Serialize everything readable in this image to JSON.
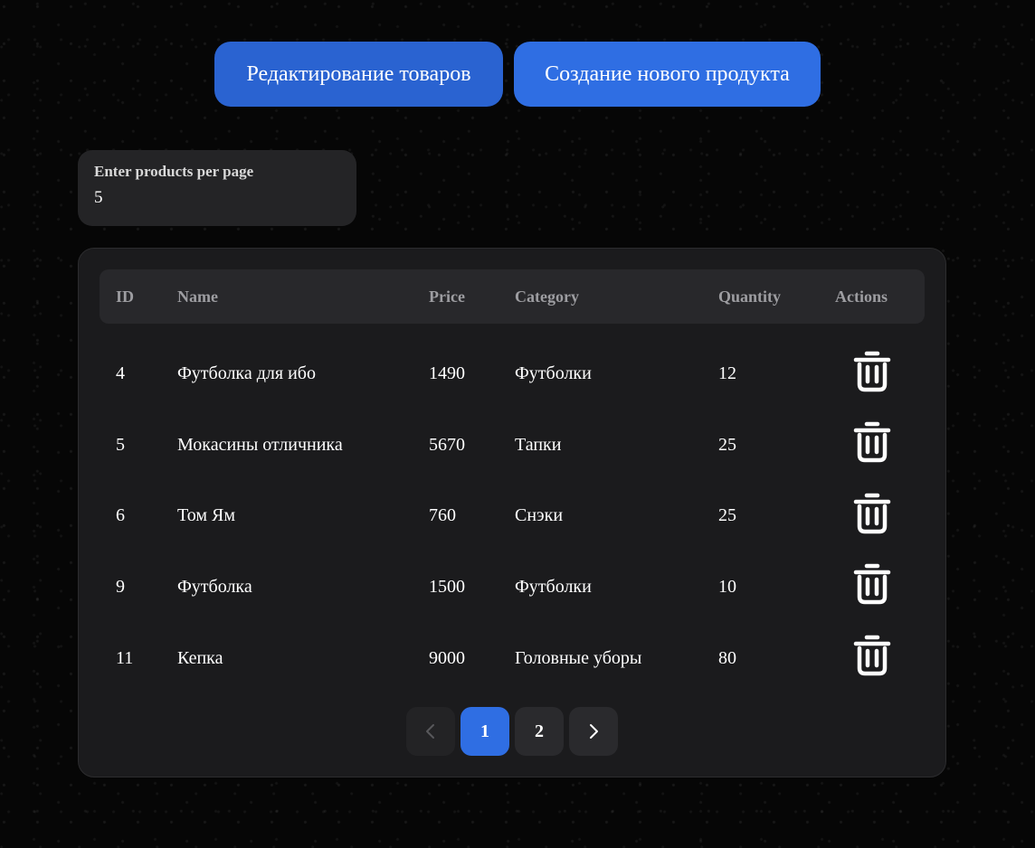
{
  "top_buttons": {
    "edit_label": "Редактирование товаров",
    "create_label": "Создание нового продукта"
  },
  "per_page": {
    "label": "Enter products per page",
    "value": "5"
  },
  "table": {
    "columns": [
      "ID",
      "Name",
      "Price",
      "Category",
      "Quantity",
      "Actions"
    ],
    "rows": [
      {
        "id": "4",
        "name": "Футболка для ибо",
        "price": "1490",
        "category": "Футболки",
        "quantity": "12"
      },
      {
        "id": "5",
        "name": "Мокасины отличника",
        "price": "5670",
        "category": "Тапки",
        "quantity": "25"
      },
      {
        "id": "6",
        "name": "Том Ям",
        "price": "760",
        "category": "Снэки",
        "quantity": "25"
      },
      {
        "id": "9",
        "name": "Футболка",
        "price": "1500",
        "category": "Футболки",
        "quantity": "10"
      },
      {
        "id": "11",
        "name": "Кепка",
        "price": "9000",
        "category": "Головные уборы",
        "quantity": "80"
      }
    ],
    "row_action_icon": "trash-icon"
  },
  "pagination": {
    "prev_icon": "chevron-left-icon",
    "next_icon": "chevron-right-icon",
    "pages": [
      "1",
      "2"
    ],
    "current_page": "1",
    "prev_disabled": true
  },
  "colors": {
    "accent": "#2f6ee3",
    "panel": "#1b1b1d",
    "header_row": "#28282b"
  }
}
